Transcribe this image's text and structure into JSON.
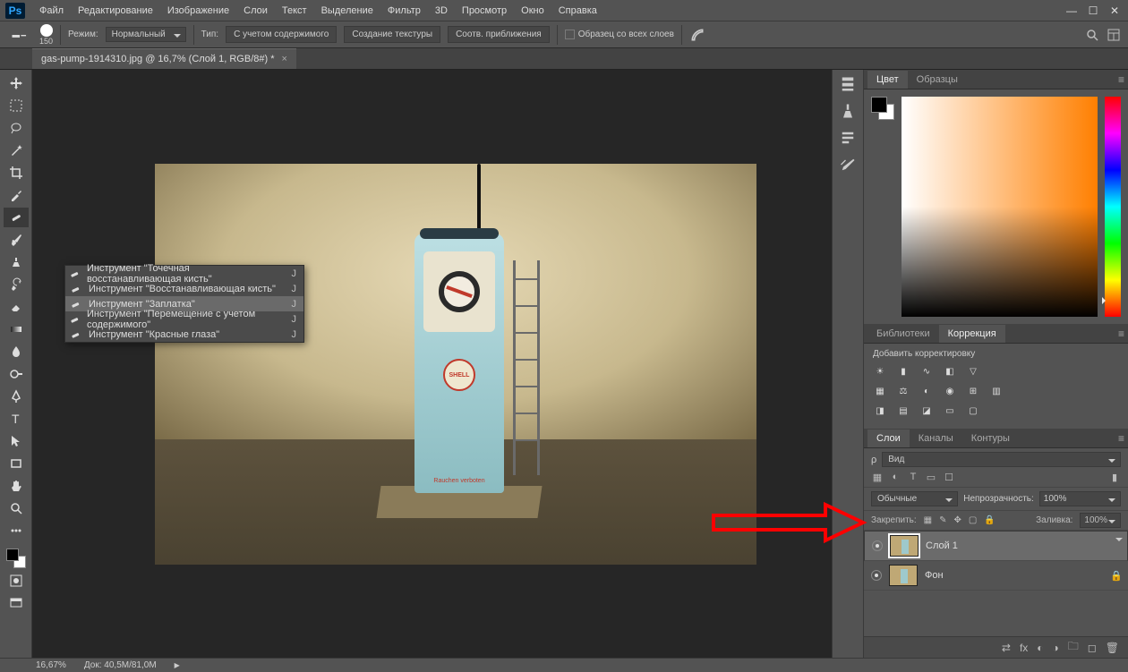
{
  "app": {
    "logo": "Ps"
  },
  "menu": [
    "Файл",
    "Редактирование",
    "Изображение",
    "Слои",
    "Текст",
    "Выделение",
    "Фильтр",
    "3D",
    "Просмотр",
    "Окно",
    "Справка"
  ],
  "options": {
    "brush_size": "150",
    "mode_label": "Режим:",
    "mode_value": "Нормальный",
    "type_label": "Тип:",
    "btn_content": "С учетом содержимого",
    "btn_texture": "Создание текстуры",
    "btn_proximity": "Соотв. приближения",
    "sample_all": "Образец со всех слоев"
  },
  "doc": {
    "title": "gas-pump-1914310.jpg @ 16,7% (Слой 1, RGB/8#) *"
  },
  "scene": {
    "shell": "SHELL",
    "label": "Rauchen verboten"
  },
  "flyout": [
    {
      "icon": "spot",
      "label": "Инструмент \"Точечная восстанавливающая кисть\"",
      "sc": "J",
      "active": false
    },
    {
      "icon": "heal",
      "label": "Инструмент \"Восстанавливающая кисть\"",
      "sc": "J",
      "active": false
    },
    {
      "icon": "patch",
      "label": "Инструмент \"Заплатка\"",
      "sc": "J",
      "active": true
    },
    {
      "icon": "move",
      "label": "Инструмент \"Перемещение с учетом содержимого\"",
      "sc": "J",
      "active": false
    },
    {
      "icon": "redeye",
      "label": "Инструмент \"Красные глаза\"",
      "sc": "J",
      "active": false
    }
  ],
  "panels": {
    "color_tab": "Цвет",
    "swatches_tab": "Образцы",
    "libs_tab": "Библиотеки",
    "adjust_tab": "Коррекция",
    "adjust_title": "Добавить корректировку",
    "layers_tab": "Слои",
    "channels_tab": "Каналы",
    "paths_tab": "Контуры",
    "kind_label": "Вид",
    "blend_value": "Обычные",
    "opacity_label": "Непрозрачность:",
    "opacity_value": "100%",
    "lock_label": "Закрепить:",
    "fill_label": "Заливка:",
    "fill_value": "100%",
    "layers": [
      {
        "name": "Слой 1",
        "locked": false,
        "selected": true
      },
      {
        "name": "Фон",
        "locked": true,
        "selected": false
      }
    ]
  },
  "status": {
    "zoom": "16,67%",
    "doc": "Док: 40,5M/81,0M"
  }
}
